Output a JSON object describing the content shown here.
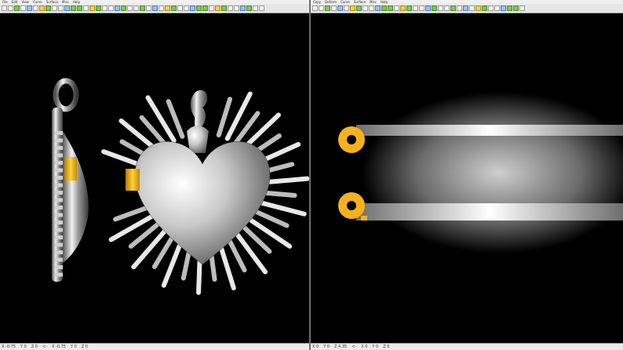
{
  "left_pane": {
    "menu": [
      "File",
      "Edit",
      "View",
      "Curve",
      "Surface",
      "Misc",
      "Help"
    ],
    "statusbar": [
      "X -0.75",
      "Y 0",
      "Z 0",
      "<-",
      "X -0.75",
      "Y 0",
      "Z 0"
    ]
  },
  "right_pane": {
    "menu": [
      "Copy",
      "Deform",
      "Curve",
      "Surface",
      "Misc",
      "Help"
    ],
    "statusbar": [
      "X 0",
      "Y 0",
      "Z 4.35",
      "<-",
      "X 0",
      "Y 0",
      "Z 0"
    ]
  },
  "colors": {
    "viewport_bg": "#000000",
    "metal": "#d8d8d8",
    "accent_gold": "#f5b21c"
  },
  "icons": [
    "pointer-icon",
    "zoom-icon",
    "pan-icon",
    "rotate-icon",
    "grid-icon",
    "render-icon"
  ]
}
